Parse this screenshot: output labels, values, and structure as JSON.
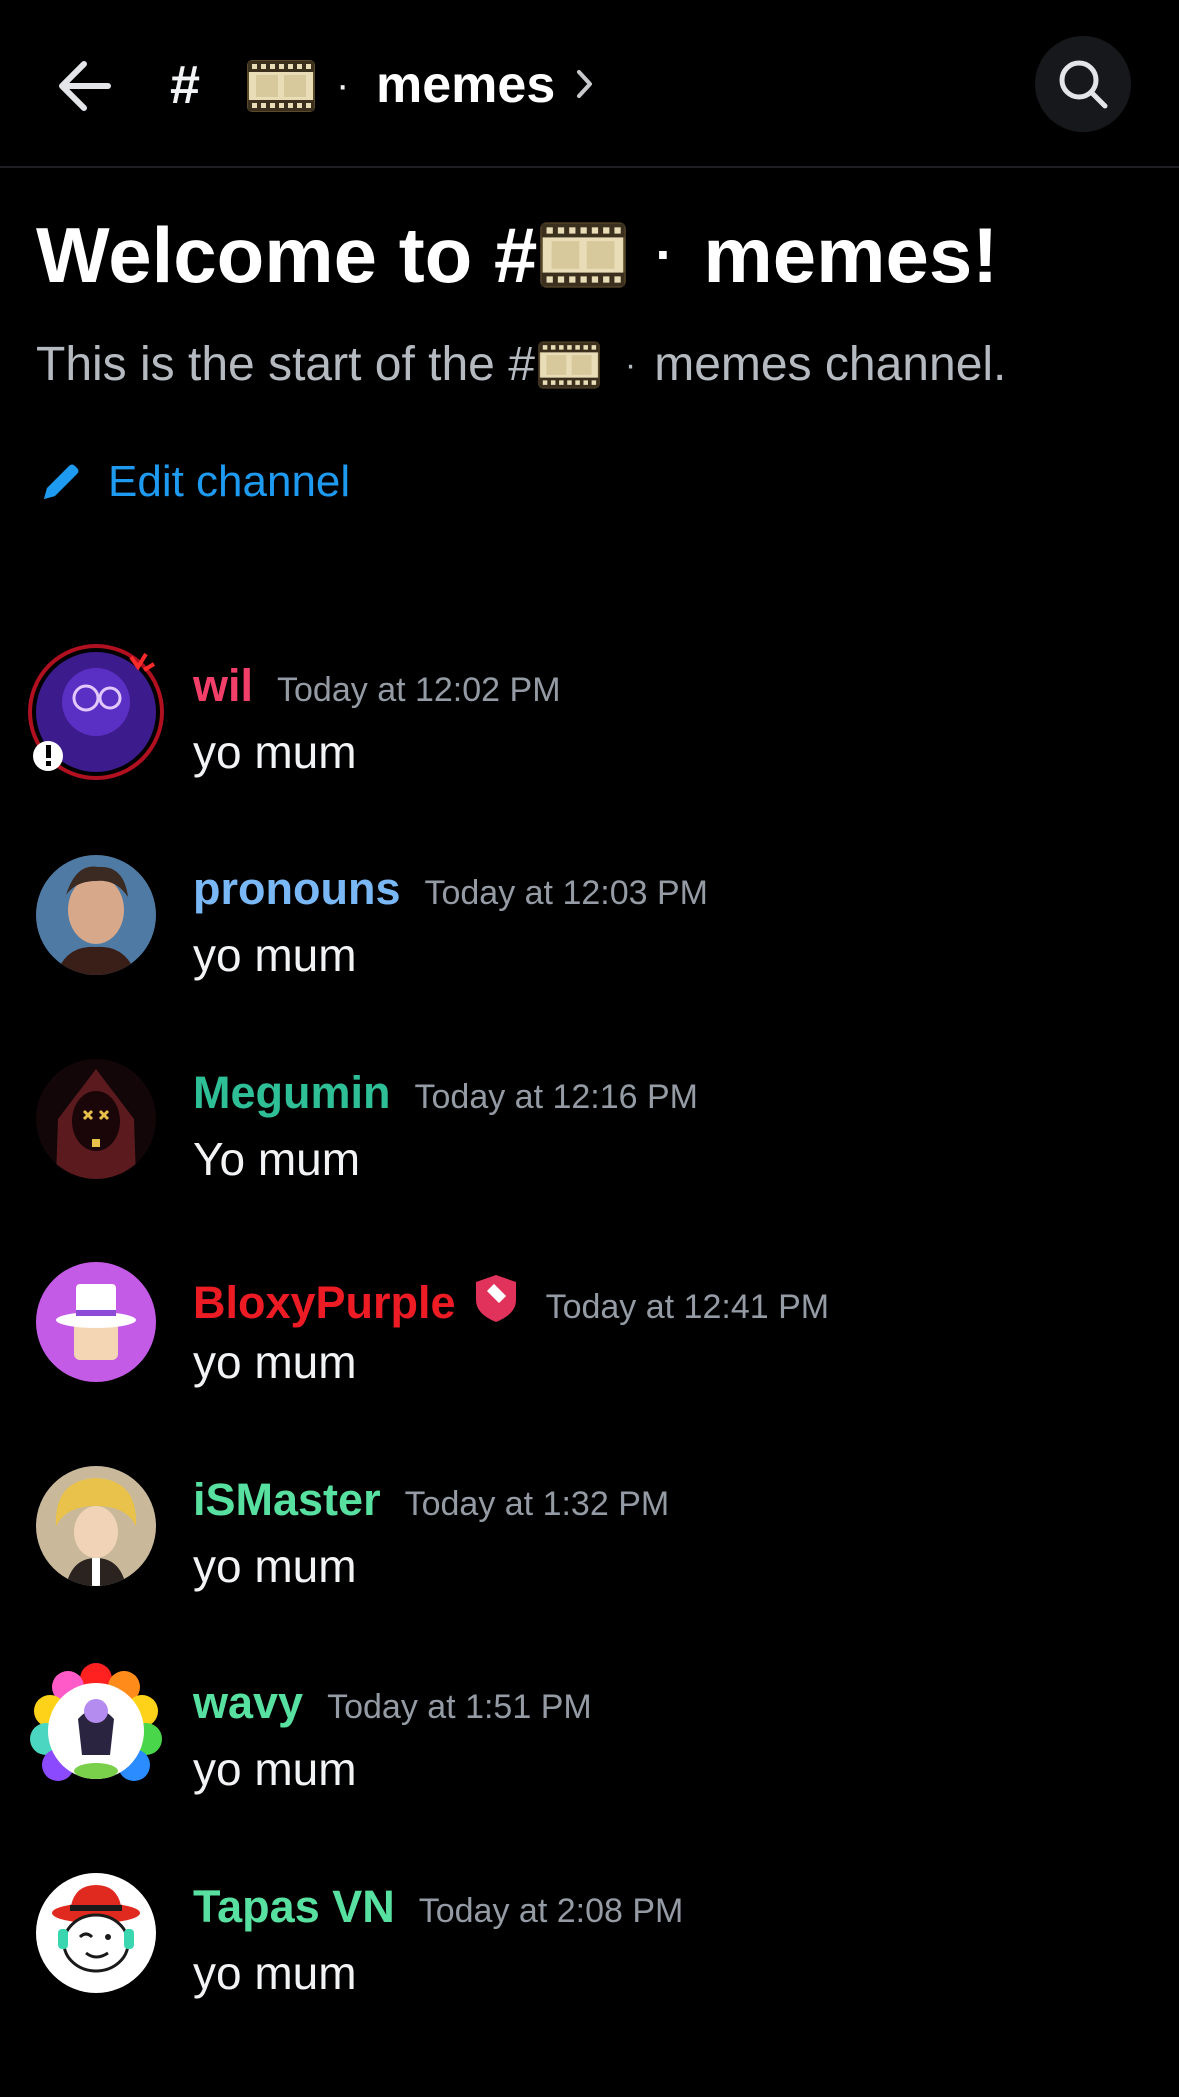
{
  "header": {
    "hash": "#",
    "separator": "·",
    "channel_name": "memes"
  },
  "welcome": {
    "title_prefix": "Welcome to #",
    "title_suffix": "memes!",
    "separator": "·",
    "subtitle_prefix": "This is the start of the #",
    "subtitle_suffix": "memes channel.",
    "edit_label": "Edit channel"
  },
  "colors": {
    "background": "#000000",
    "link": "#1e9bf0",
    "timestamp": "#949ba4"
  },
  "messages": [
    {
      "author": "wil",
      "color": "#f23f6a",
      "time": "Today at 12:02 PM",
      "text": "yo mum",
      "avatar": "purple-character-avatar"
    },
    {
      "author": "pronouns",
      "color": "#7ab8f5",
      "time": "Today at 12:03 PM",
      "text": "yo mum",
      "avatar": "photo-person-avatar"
    },
    {
      "author": "Megumin",
      "color": "#2fbf97",
      "time": "Today at 12:16 PM",
      "text": "Yo mum",
      "avatar": "dark-hooded-avatar"
    },
    {
      "author": "BloxyPurple",
      "color": "#ed1c24",
      "time": "Today at 12:41 PM",
      "text": "yo mum",
      "avatar": "roblox-tophat-avatar",
      "badge": "moderator-shield-icon"
    },
    {
      "author": "iSMaster",
      "color": "#57e0a0",
      "time": "Today at 1:32 PM",
      "text": "yo mum",
      "avatar": "blonde-character-avatar"
    },
    {
      "author": "wavy",
      "color": "#57e0a0",
      "time": "Today at 1:51 PM",
      "text": "yo mum",
      "avatar": "rainbow-clown-avatar"
    },
    {
      "author": "Tapas VN",
      "color": "#57e0a0",
      "time": "Today at 2:08 PM",
      "text": "yo mum",
      "avatar": "red-hat-cartoon-avatar"
    }
  ]
}
